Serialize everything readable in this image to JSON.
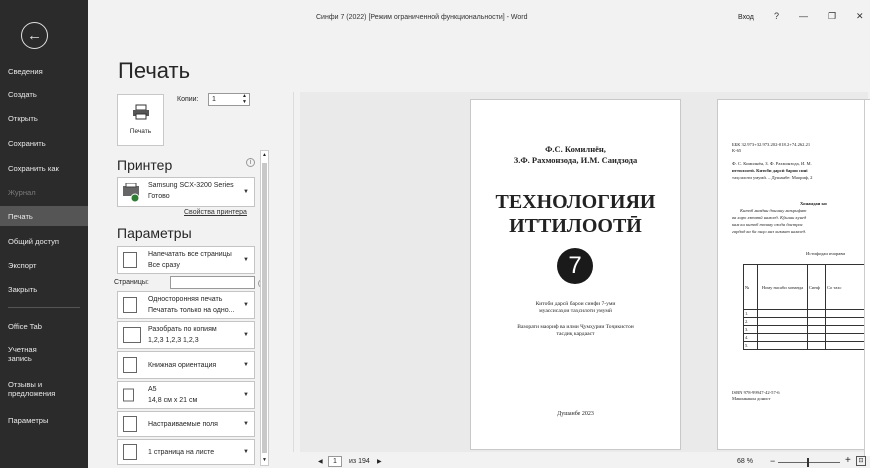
{
  "window": {
    "title": "Синфи 7 (2022) [Режим ограниченной функциональности]  -  Word",
    "login": "Вход",
    "help": "?",
    "minimize": "—",
    "restore": "❐",
    "close": "✕"
  },
  "sidebar": {
    "back": "←",
    "items": [
      {
        "label": "Сведения"
      },
      {
        "label": "Создать"
      },
      {
        "label": "Открыть"
      },
      {
        "label": "Сохранить"
      },
      {
        "label": "Сохранить как"
      },
      {
        "label": "Журнал"
      },
      {
        "label": "Печать"
      },
      {
        "label": "Общий доступ"
      },
      {
        "label": "Экспорт"
      },
      {
        "label": "Закрыть"
      },
      {
        "label": "Office Tab"
      },
      {
        "label": "Учетная запись"
      },
      {
        "label": "Отзывы и предложения"
      },
      {
        "label": "Параметры"
      }
    ]
  },
  "print": {
    "heading": "Печать",
    "button_label": "Печать",
    "copies_label": "Копии:",
    "copies_value": "1",
    "printer_heading": "Принтер",
    "printer_name": "Samsung SCX-3200 Series",
    "printer_status": "Готово",
    "printer_props": "Свойства принтера",
    "params_heading": "Параметры",
    "settings": [
      {
        "line1": "Напечатать все страницы",
        "line2": "Все сразу"
      },
      {
        "line1": "Односторонняя печать",
        "line2": "Печатать только на одно..."
      },
      {
        "line1": "Разобрать по копиям",
        "line2": "1,2,3   1,2,3   1,2,3"
      },
      {
        "line1": "Книжная ориентация",
        "line2": ""
      },
      {
        "line1": "A5",
        "line2": "14,8 см x 21 см"
      },
      {
        "line1": "Настраиваемые поля",
        "line2": ""
      },
      {
        "line1": "1 страница на листе",
        "line2": ""
      }
    ],
    "pages_label": "Страницы:",
    "info": "i"
  },
  "preview": {
    "page1": {
      "author1": "Ф.С. Комилнён,",
      "author2": "З.Ф. Рахмонзода, И.М. Саидзода",
      "title1": "ТЕХНОЛОГИЯИ",
      "title2": "ИТТИЛООТӢ",
      "number": "7",
      "desc1": "Китоби дарсӣ барои синфи 7-уми",
      "desc2": "муассисаҳои таҳсилоти умумӣ",
      "approved1": "Вазорати маориф ва илми Ҷумҳурии Тоҷикистон",
      "approved2": "тасдиқ кардааст",
      "city": "Душанбе 2023"
    },
    "page2": {
      "bbk": "ББК 32.973+32.973.202-018.2+74.262.21",
      "k": "К-65",
      "ref1": "Ф. С. Комилнён, З. Ф. Рахмонзода, И. М.",
      "ref2": "иттилоотӣ. Китоби дарсӣ барои сині",
      "ref3": "таҳсилоти умумӣ. – Душанбе: Маориф, 2",
      "heading": "Хонандаи ки",
      "intro1": "Китоб мавдин донишу маърифат",
      "intro2": "ва хиро хзтатӣ намоед. Кўшиш кунед",
      "intro3": "кам ки китоб тозаву озода дастрас",
      "intro4": "гардад ва ба онҳо низ хизмат намоед.",
      "table_title": "Истифодаи ичорави",
      "col_no": "№",
      "col_name": "Ному насаби хонанда",
      "col_class": "Синф",
      "col_year": "Со тахс",
      "rows": [
        "1.",
        "2.",
        "3.",
        "4.",
        "5."
      ],
      "isbn": "ISBN 978-99947-42-57-6",
      "print_note": "Маконкакон донист"
    }
  },
  "status": {
    "page_current": "1",
    "page_of": "из 194",
    "zoom": "68 %"
  }
}
